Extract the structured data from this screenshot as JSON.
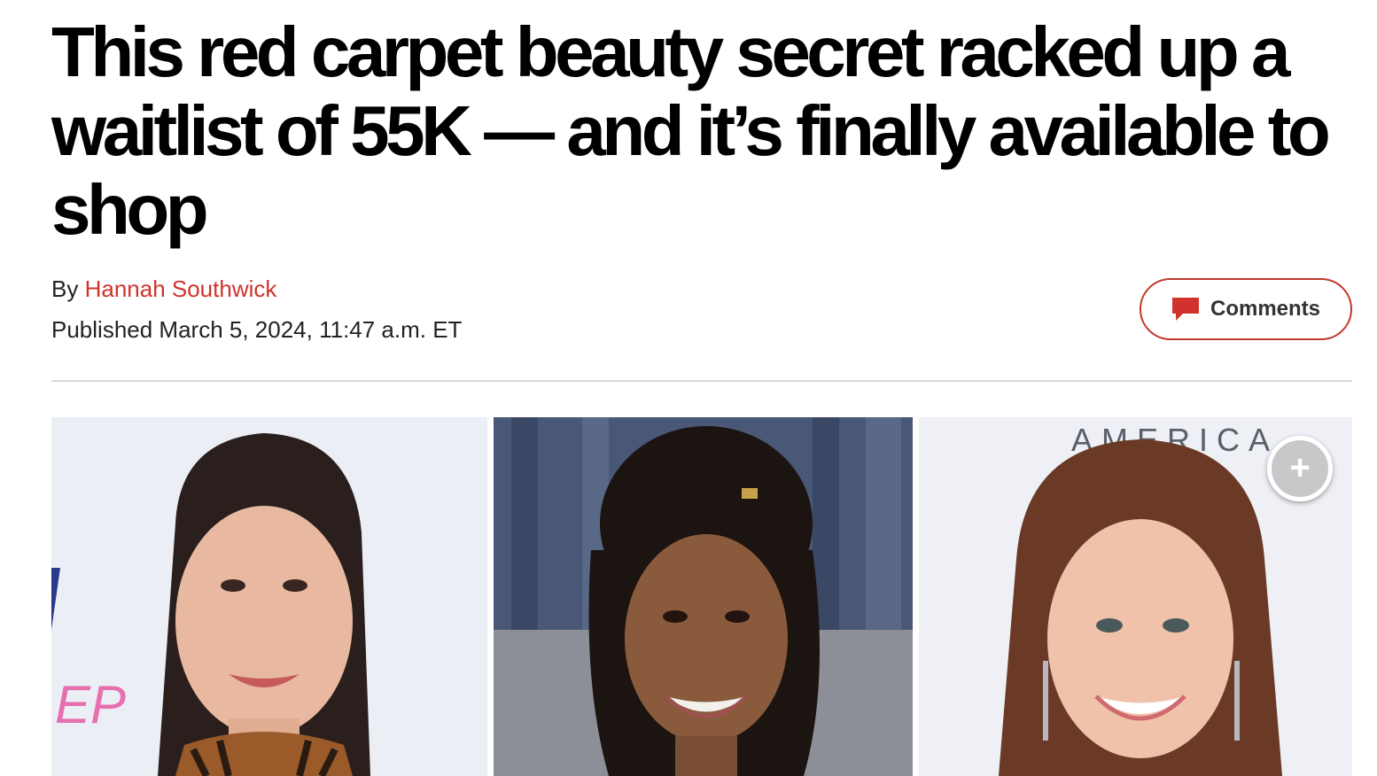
{
  "article": {
    "headline": "This red carpet beauty secret racked up a waitlist of 55K — and it’s finally available to shop",
    "byline_prefix": "By",
    "author": "Hannah Southwick",
    "published": "Published March 5, 2024, 11:47 a.m. ET"
  },
  "comments_button": {
    "label": "Comments"
  },
  "photo_collage": {
    "backdrop_text_right": "AMERICA",
    "backdrop_text_left": "EP",
    "expand_symbol": "+"
  },
  "colors": {
    "accent": "#d0332c",
    "text": "#000000"
  },
  "icons": {
    "comments": "speech-bubble-icon",
    "expand": "plus-icon"
  }
}
